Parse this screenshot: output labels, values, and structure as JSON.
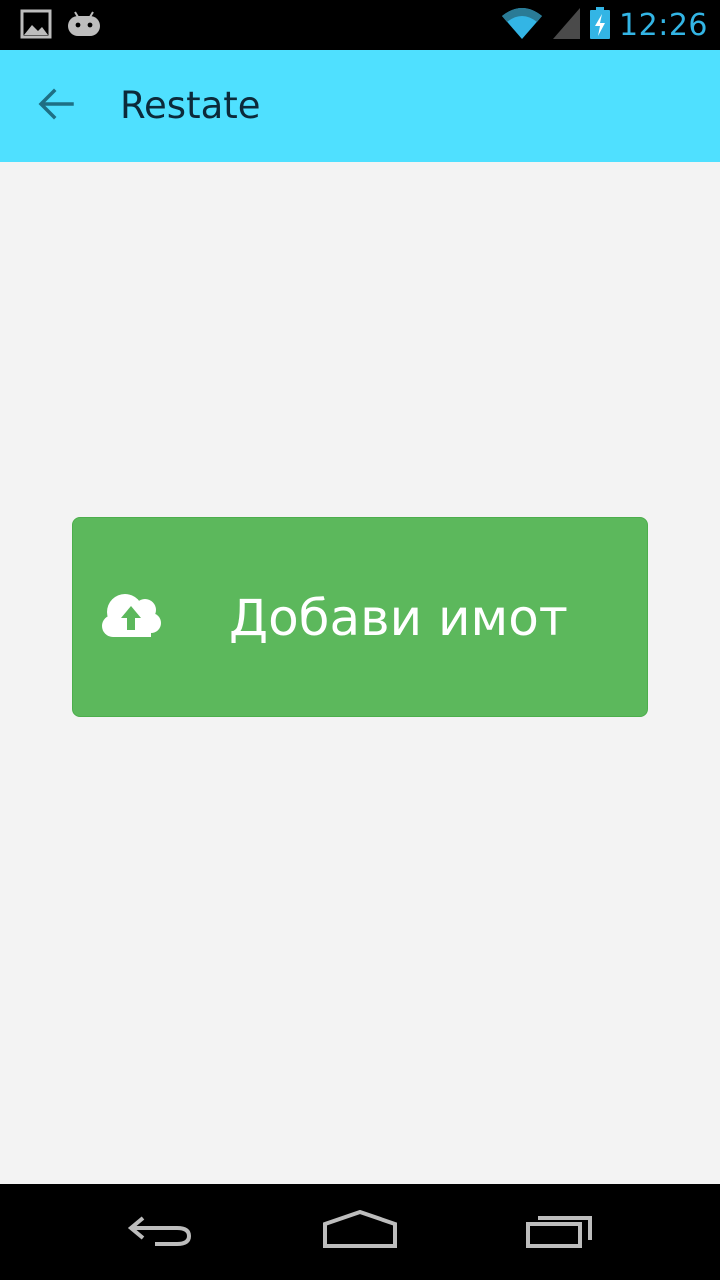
{
  "status_bar": {
    "time": "12:26",
    "icons": [
      "image-notification-icon",
      "android-notification-icon",
      "wifi-icon",
      "cell-signal-icon",
      "battery-charging-icon"
    ]
  },
  "app_bar": {
    "title": "Restate",
    "back_icon": "arrow-left-icon",
    "background_color": "#4fe0ff"
  },
  "main": {
    "add_property_button": {
      "label": "Добави имот",
      "icon": "cloud-upload-icon",
      "color": "#5cb85c"
    }
  },
  "nav_bar": {
    "buttons": [
      "back-icon",
      "home-icon",
      "recent-apps-icon"
    ]
  },
  "colors": {
    "accent": "#33b5e5",
    "background": "#f3f3f3"
  }
}
